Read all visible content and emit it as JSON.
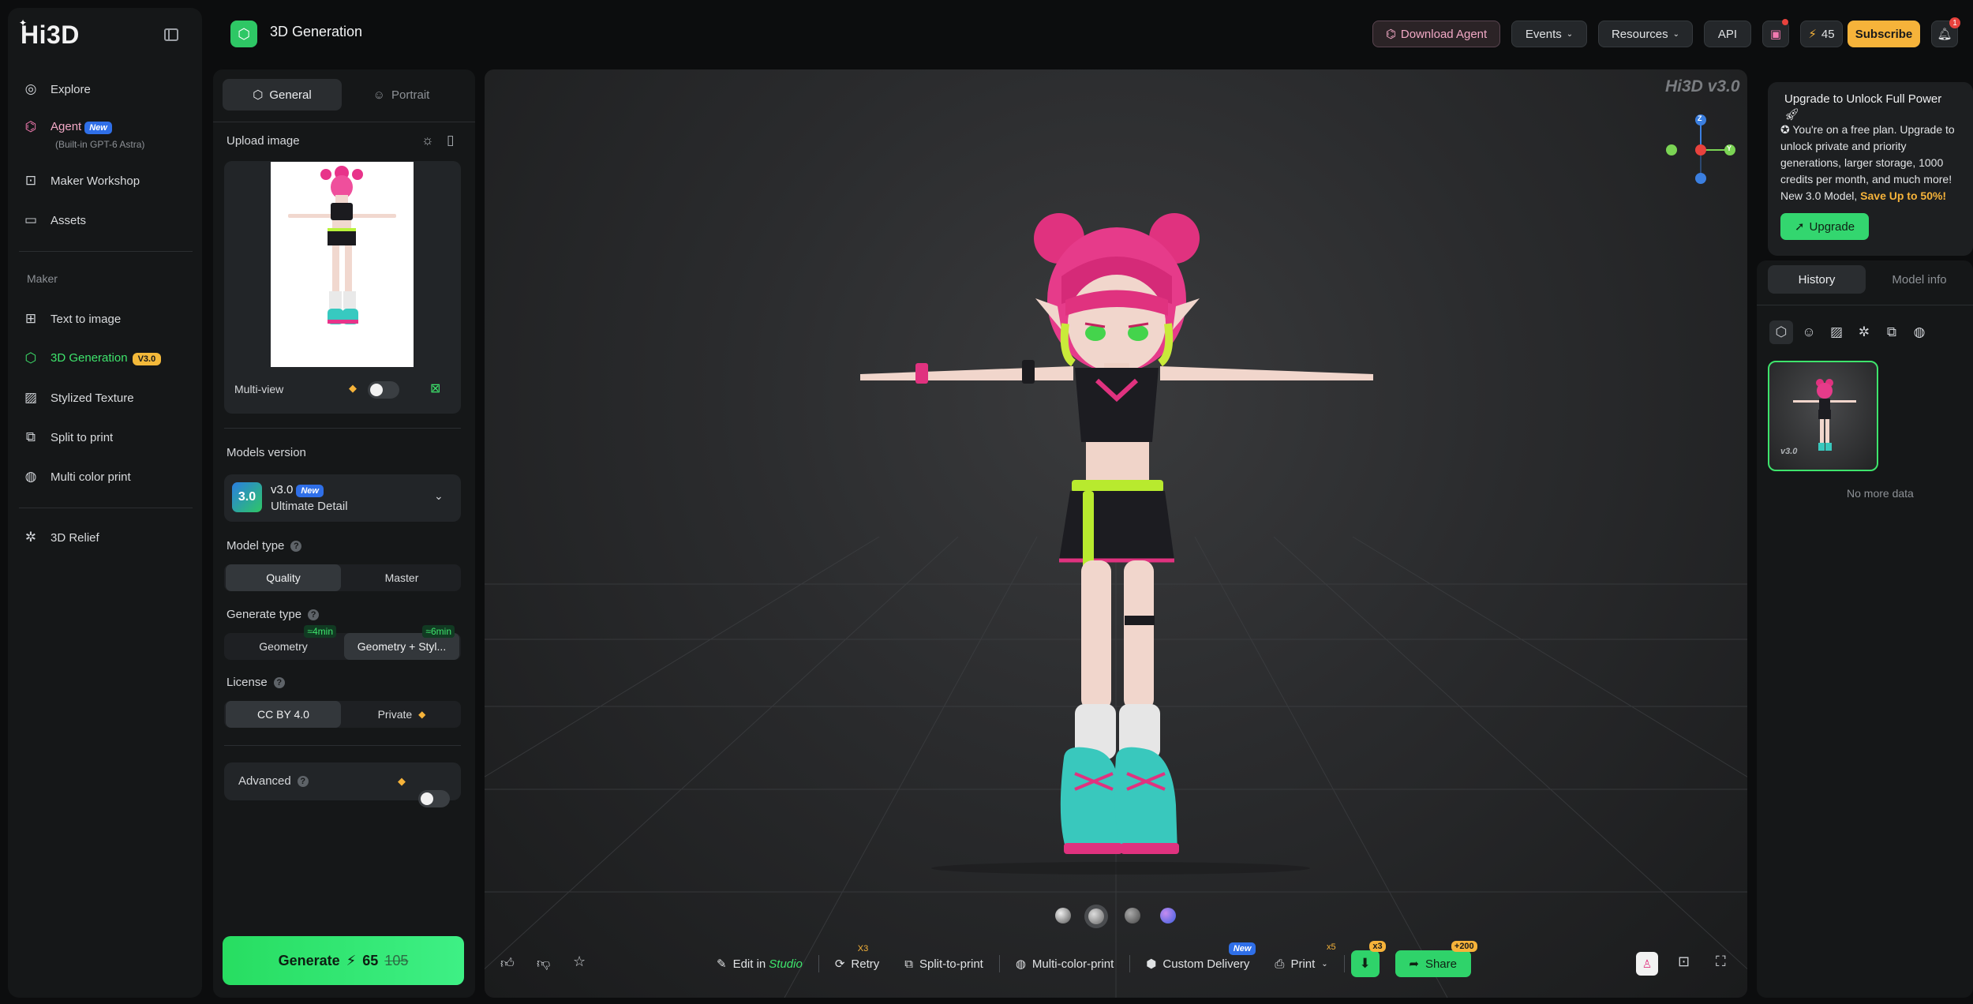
{
  "app": {
    "logo": "Hi3D"
  },
  "sidebar": {
    "items": [
      {
        "label": "Explore"
      },
      {
        "label": "Agent",
        "badge": "New",
        "sub": "(Built-in GPT-6 Astra)"
      },
      {
        "label": "Maker Workshop"
      },
      {
        "label": "Assets"
      }
    ],
    "section_label": "Maker",
    "maker_items": [
      {
        "label": "Text to image"
      },
      {
        "label": "3D Generation",
        "badge": "V3.0"
      },
      {
        "label": "Stylized Texture"
      },
      {
        "label": "Split to print"
      },
      {
        "label": "Multi color print"
      }
    ],
    "relief": "3D Relief"
  },
  "header": {
    "title": "3D Generation",
    "download_agent": "Download Agent",
    "events": "Events",
    "resources": "Resources",
    "api": "API",
    "credits": "45",
    "subscribe": "Subscribe",
    "notifications": "1"
  },
  "left": {
    "tab_general": "General",
    "tab_portrait": "Portrait",
    "upload_label": "Upload image",
    "multiview": "Multi-view",
    "models_version_label": "Models version",
    "model_badge": "3.0",
    "model_name": "v3.0",
    "model_new": "New",
    "model_desc": "Ultimate Detail",
    "model_type_label": "Model type",
    "model_type_options": [
      "Quality",
      "Master"
    ],
    "generate_type_label": "Generate type",
    "generate_type_options": [
      "Geometry",
      "Geometry + Styl..."
    ],
    "generate_type_times": [
      "≈4min",
      "≈6min"
    ],
    "license_label": "License",
    "license_options": [
      "CC BY 4.0",
      "Private"
    ],
    "advanced": "Advanced",
    "generate": "Generate",
    "cost": "65",
    "old_cost": "105"
  },
  "viewport": {
    "watermark": "Hi3D v3.0",
    "axes": {
      "z": "Z",
      "y": "Y"
    },
    "toolbar": {
      "edit": "Edit in",
      "studio": "Studio",
      "retry": "Retry",
      "retry_mult": "X3",
      "split": "Split-to-print",
      "multicolor": "Multi-color-print",
      "custom": "Custom Delivery",
      "custom_new": "New",
      "print": "Print",
      "print_mult": "x5",
      "download_mult": "x3",
      "share": "Share",
      "share_bonus": "+200"
    }
  },
  "right": {
    "upgrade_title": "Upgrade to Unlock Full Power",
    "upgrade_body_1": "You're on a free plan. Upgrade to unlock private and priority generations, larger storage, 1000 credits per month, and much more! New 3.0 Model,",
    "upgrade_body_save": "Save Up to 50%!",
    "upgrade_btn": "Upgrade",
    "tab_history": "History",
    "tab_model_info": "Model info",
    "thumb_tag": "v3.0",
    "no_data": "No more data"
  }
}
